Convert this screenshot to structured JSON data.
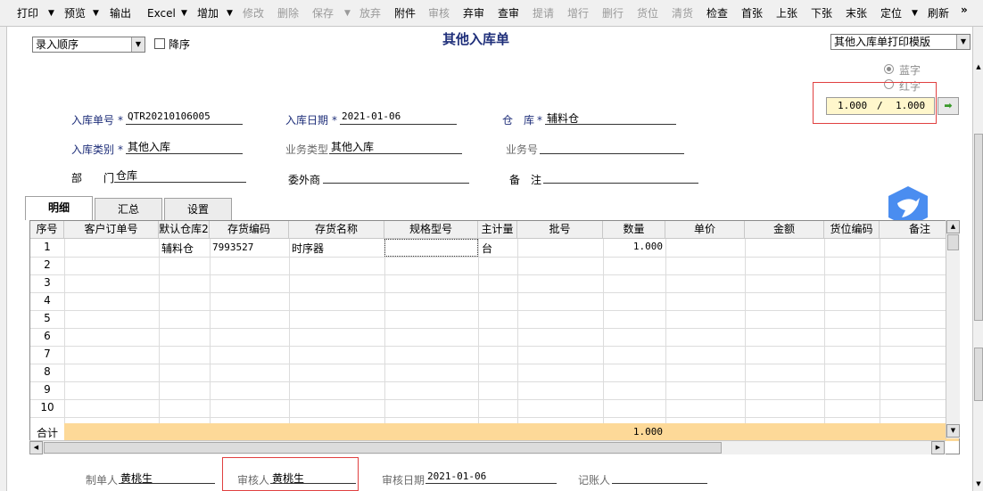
{
  "toolbar": {
    "print": "打印",
    "preview": "预览",
    "export": "输出",
    "excel": "Excel",
    "add": "增加",
    "modify": "修改",
    "delete": "删除",
    "save": "保存",
    "abandon": "放弃",
    "attachment": "附件",
    "audit": "审核",
    "unaudit": "弃审",
    "query": "查审",
    "request": "提请",
    "add_row": "增行",
    "delete_row": "删行",
    "location": "货位",
    "clear_location": "清货",
    "check": "检查",
    "first": "首张",
    "prev": "上张",
    "next": "下张",
    "last": "末张",
    "locate": "定位",
    "refresh": "刷新",
    "more": "»"
  },
  "form": {
    "sort_select": "录入顺序",
    "desc_label": "降序",
    "title": "其他入库单",
    "template_select": "其他入库单打印模版",
    "blue_label": "蓝字",
    "red_label": "红字",
    "page_current": "1.000",
    "page_sep": "/",
    "page_total": "1.000"
  },
  "fields": {
    "doc_no_label": "入库单号",
    "doc_no": "QTR20210106005",
    "date_label": "入库日期",
    "date": "2021-01-06",
    "warehouse_label": "仓　库",
    "warehouse": "辅料仓",
    "type_label": "入库类别",
    "type": "其他入库",
    "biz_type_label": "业务类型",
    "biz_type": "其他入库",
    "biz_no_label": "业务号",
    "dept_label_1": "部",
    "dept_label_2": "门",
    "dept": "仓库",
    "outsource_label": "委外商",
    "remark_label": "备　注"
  },
  "tabs": [
    "明细",
    "汇总",
    "设置"
  ],
  "grid": {
    "columns": [
      "序号",
      "客户订单号",
      "默认仓库2",
      "存货编码",
      "存货名称",
      "规格型号",
      "主计量",
      "批号",
      "数量",
      "单价",
      "金额",
      "货位编码",
      "备注"
    ],
    "rows": [
      {
        "no": "1",
        "warehouse": "辅料仓",
        "code": "7993527",
        "name": "时序器",
        "unit": "台",
        "qty": "1.000"
      },
      {
        "no": "2"
      },
      {
        "no": "3"
      },
      {
        "no": "4"
      },
      {
        "no": "5"
      },
      {
        "no": "6"
      },
      {
        "no": "7"
      },
      {
        "no": "8"
      },
      {
        "no": "9"
      },
      {
        "no": "10"
      }
    ],
    "total_label": "合计",
    "total_qty": "1.000"
  },
  "footer": {
    "maker_label": "制单人",
    "maker": "黄桃生",
    "auditor_label": "审核人",
    "auditor": "黄桃生",
    "audit_date_label": "审核日期",
    "audit_date": "2021-01-06",
    "bookkeeper_label": "记账人"
  },
  "colors": {
    "label_blue": "#1f2f7a",
    "total_row": "#fdd998",
    "pager_bg": "#fff7cc",
    "highlight_red": "#e04040"
  }
}
